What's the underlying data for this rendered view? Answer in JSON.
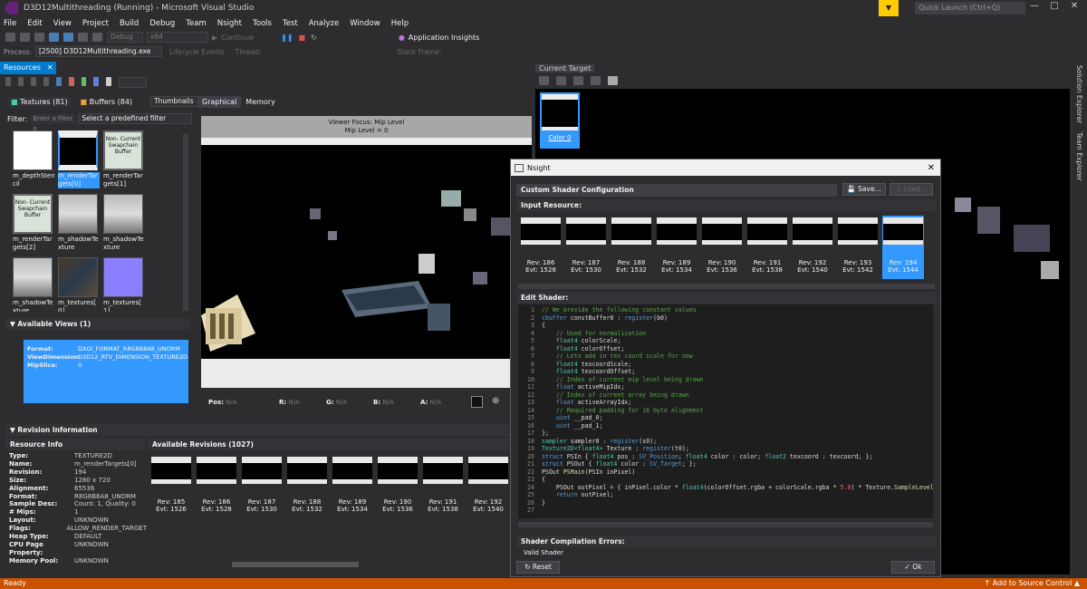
{
  "window": {
    "title": "D3D12Multithreading (Running) - Microsoft Visual Studio",
    "quick_launch": "Quick Launch (Ctrl+Q)"
  },
  "menu": [
    "File",
    "Edit",
    "View",
    "Project",
    "Build",
    "Debug",
    "Team",
    "Nsight",
    "Tools",
    "Test",
    "Analyze",
    "Window",
    "Help"
  ],
  "toolbar": {
    "config": "Debug",
    "platform": "x64",
    "continue": "Continue",
    "insights": "Application Insights"
  },
  "toolbar2": {
    "process_label": "Process:",
    "process_value": "[2500] D3D12Multithreading.exe",
    "lifecycle": "Lifecycle Events",
    "thread": "Thread:",
    "stack": "Stack Frame:"
  },
  "resources": {
    "tab": "Resources",
    "textures": "Textures (81)",
    "buffers": "Buffers (84)",
    "view_mode": "Thumbnails",
    "filter_label": "Filter:",
    "filter_placeholder": "Enter a filter o",
    "predefined": "Select a predefined filter",
    "thumbs": [
      {
        "label": "m_depthSten cil",
        "kind": "depth"
      },
      {
        "label": "m_renderTar gets[0]",
        "kind": "dark",
        "selected": true
      },
      {
        "label": "m_renderTar gets[1]",
        "kind": "swap",
        "text": "Non- Current Swapchain Buffer"
      },
      {
        "label": "m_renderTar gets[2]",
        "kind": "swap",
        "text": "Non- Current Swapchain Buffer"
      },
      {
        "label": "m_shadowTe xture",
        "kind": "shadow"
      },
      {
        "label": "m_shadowTe xture",
        "kind": "shadow"
      },
      {
        "label": "m_shadowTe xture",
        "kind": "shadow"
      },
      {
        "label": "m_textures[ 0]",
        "kind": "tex"
      },
      {
        "label": "m_textures[ 1]",
        "kind": "normal"
      }
    ],
    "views_header": "Available Views (1)",
    "views": [
      {
        "k": "Format:",
        "v": "DXGI_FORMAT_R8G8B8A8_UNORM"
      },
      {
        "k": "ViewDimension:",
        "v": "D3D12_RTV_DIMENSION_TEXTURE2D"
      },
      {
        "k": "MipSlice:",
        "v": "0"
      }
    ],
    "graphical_tab": "Graphical",
    "memory_tab": "Memory",
    "viewer_focus": "Viewer Focus: Mip Level",
    "mip_level": "Mip Level = 0",
    "pix": {
      "pos": "Pos:",
      "pos_v": "N/A",
      "r": "R:",
      "r_v": "N/A",
      "g": "G:",
      "g_v": "N/A",
      "b": "B:",
      "b_v": "N/A",
      "a": "A:",
      "a_v": "N/A"
    }
  },
  "revision": {
    "header": "Revision Information",
    "info_header": "Resource Info",
    "info": [
      {
        "k": "Type:",
        "v": "TEXTURE2D"
      },
      {
        "k": "Name:",
        "v": "m_renderTargets[0]"
      },
      {
        "k": "Revision:",
        "v": "194"
      },
      {
        "k": "Size:",
        "v": "1280 x 720"
      },
      {
        "k": "Alignment:",
        "v": "65536"
      },
      {
        "k": "Format:",
        "v": "R8G8B8A8_UNORM"
      },
      {
        "k": "Sample Desc:",
        "v": "Count: 1, Quality: 0"
      },
      {
        "k": "# Mips:",
        "v": "1"
      },
      {
        "k": "Layout:",
        "v": "UNKNOWN"
      },
      {
        "k": "Flags:",
        "v": "ALLOW_RENDER_TARGET"
      },
      {
        "k": "Heap Type:",
        "v": "DEFAULT"
      },
      {
        "k": "CPU Page Property:",
        "v": "UNKNOWN"
      },
      {
        "k": "Memory Pool:",
        "v": "UNKNOWN"
      }
    ],
    "avail_header": "Available Revisions (1027)",
    "revs": [
      {
        "rev": "Rev: 185",
        "evt": "Evt: 1526"
      },
      {
        "rev": "Rev: 186",
        "evt": "Evt: 1528"
      },
      {
        "rev": "Rev: 187",
        "evt": "Evt: 1530"
      },
      {
        "rev": "Rev: 188",
        "evt": "Evt: 1532"
      },
      {
        "rev": "Rev: 189",
        "evt": "Evt: 1534"
      },
      {
        "rev": "Rev: 190",
        "evt": "Evt: 1536"
      },
      {
        "rev": "Rev: 191",
        "evt": "Evt: 1538"
      },
      {
        "rev": "Rev: 192",
        "evt": "Evt: 1540"
      }
    ]
  },
  "current_target": {
    "tab": "Current Target",
    "thumb_label": "Color 0"
  },
  "side_tabs": [
    "Solution Explorer",
    "Team Explorer"
  ],
  "nsight": {
    "title": "Nsight",
    "custom_header": "Custom Shader Configuration",
    "save": "Save...",
    "load": "Load...",
    "input_header": "Input Resource:",
    "revs": [
      {
        "rev": "Rev: 186",
        "evt": "Evt: 1528"
      },
      {
        "rev": "Rev: 187",
        "evt": "Evt: 1530"
      },
      {
        "rev": "Rev: 188",
        "evt": "Evt: 1532"
      },
      {
        "rev": "Rev: 189",
        "evt": "Evt: 1534"
      },
      {
        "rev": "Rev: 190",
        "evt": "Evt: 1536"
      },
      {
        "rev": "Rev: 191",
        "evt": "Evt: 1538"
      },
      {
        "rev": "Rev: 192",
        "evt": "Evt: 1540"
      },
      {
        "rev": "Rev: 193",
        "evt": "Evt: 1542"
      },
      {
        "rev": "Rev: 194",
        "evt": "Evt: 1544",
        "selected": true
      }
    ],
    "edit_header": "Edit Shader:",
    "code": [
      [
        [
          "cm",
          "// We provide the following constant values"
        ]
      ],
      [
        [
          "kw",
          "cbuffer"
        ],
        [
          "pl",
          " constBuffer0 : "
        ],
        [
          "kw",
          "register"
        ],
        [
          "pl",
          "(b0)"
        ]
      ],
      [
        [
          "pl",
          "{"
        ]
      ],
      [
        [
          "cm",
          "    // Used for normalization"
        ]
      ],
      [
        [
          "ty",
          "    float4"
        ],
        [
          "pl",
          " colorScale;"
        ]
      ],
      [
        [
          "ty",
          "    float4"
        ],
        [
          "pl",
          " colorOffset;"
        ]
      ],
      [
        [
          "cm",
          "    // Lets add in tex coord scale for now"
        ]
      ],
      [
        [
          "ty",
          "    float4"
        ],
        [
          "pl",
          " texcoordScale;"
        ]
      ],
      [
        [
          "ty",
          "    float4"
        ],
        [
          "pl",
          " texcoordOffset;"
        ]
      ],
      [
        [
          "cm",
          "    // Index of current mip level being drawn"
        ]
      ],
      [
        [
          "kw",
          "    float"
        ],
        [
          "pl",
          " activeMipIdx;"
        ]
      ],
      [
        [
          "cm",
          "    // Index of current array being drawn"
        ]
      ],
      [
        [
          "kw",
          "    float"
        ],
        [
          "pl",
          " activeArrayIdx;"
        ]
      ],
      [
        [
          "cm",
          "    // Required padding for 16 byte alignment"
        ]
      ],
      [
        [
          "kw",
          "    uint"
        ],
        [
          "pl",
          " __pad_0;"
        ]
      ],
      [
        [
          "kw",
          "    uint"
        ],
        [
          "pl",
          " __pad_1;"
        ]
      ],
      [
        [
          "pl",
          "};"
        ]
      ],
      [
        [
          "ty",
          "sampler"
        ],
        [
          "pl",
          " sampler0 : "
        ],
        [
          "kw",
          "register"
        ],
        [
          "pl",
          "(s0);"
        ]
      ],
      [
        [
          "ty",
          "Texture2D<float4>"
        ],
        [
          "pl",
          " Texture : "
        ],
        [
          "kw",
          "register"
        ],
        [
          "pl",
          "(t0);"
        ]
      ],
      [
        [
          "kw",
          "struct"
        ],
        [
          "pl",
          " PSIn { "
        ],
        [
          "ty",
          "float4"
        ],
        [
          "pl",
          " pos : "
        ],
        [
          "kw",
          "SV_Position"
        ],
        [
          "pl",
          "; "
        ],
        [
          "ty",
          "float4"
        ],
        [
          "pl",
          " color : color; "
        ],
        [
          "ty",
          "float2"
        ],
        [
          "pl",
          " texcoord : texcoord; };"
        ]
      ],
      [
        [
          "kw",
          "struct"
        ],
        [
          "pl",
          " PSOut { "
        ],
        [
          "ty",
          "float4"
        ],
        [
          "pl",
          " color : "
        ],
        [
          "kw",
          "SV_Target"
        ],
        [
          "pl",
          "; };"
        ]
      ],
      [
        [
          "pl",
          "PSOut "
        ],
        [
          "fn",
          "PSMain"
        ],
        [
          "pl",
          "(PSIn inPixel)"
        ]
      ],
      [
        [
          "pl",
          "{"
        ]
      ],
      [
        [
          "pl",
          "    PSOut outPixel = { inPixel.color * "
        ],
        [
          "ty",
          "float4"
        ],
        [
          "pl",
          "(colorOffset.rgba + colorScale.rgba * "
        ],
        [
          "rd",
          "5.0"
        ],
        [
          "pl",
          ") * Texture."
        ],
        [
          "fn",
          "SampleLevel"
        ],
        [
          "pl",
          "(sampler"
        ]
      ],
      [
        [
          "kw",
          "    return"
        ],
        [
          "pl",
          " outPixel;"
        ]
      ],
      [
        [
          "pl",
          "}"
        ]
      ],
      [
        [
          "pl",
          ""
        ]
      ]
    ],
    "errors_header": "Shader Compilation Errors:",
    "errors_text": "Valid Shader",
    "reset": "Reset",
    "ok": "Ok"
  },
  "status": {
    "left": "Ready",
    "right": "Add to Source Control"
  },
  "colors": {
    "accent": "#007acc",
    "status": "#ca5100",
    "selected": "#3399ff"
  }
}
